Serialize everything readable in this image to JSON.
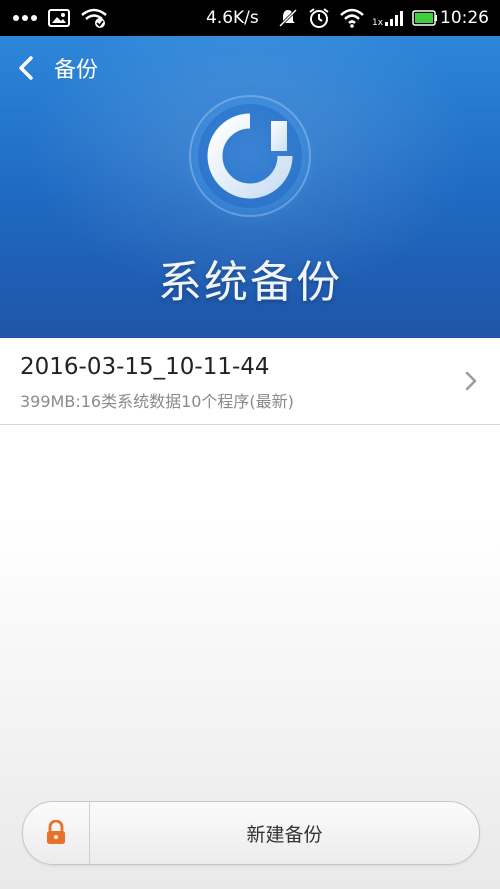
{
  "status_bar": {
    "speed": "4.6K/s",
    "signal_label": "1x",
    "time": "10:26"
  },
  "header": {
    "back_label": "备份",
    "title": "系统备份"
  },
  "backups": [
    {
      "name": "2016-03-15_10-11-44",
      "description": "399MB:16类系统数据10个程序(最新)"
    }
  ],
  "footer": {
    "new_backup_label": "新建备份"
  },
  "colors": {
    "header_blue": "#1f6bc4",
    "lock_orange": "#e8722a",
    "battery_green": "#3ecf3e"
  }
}
